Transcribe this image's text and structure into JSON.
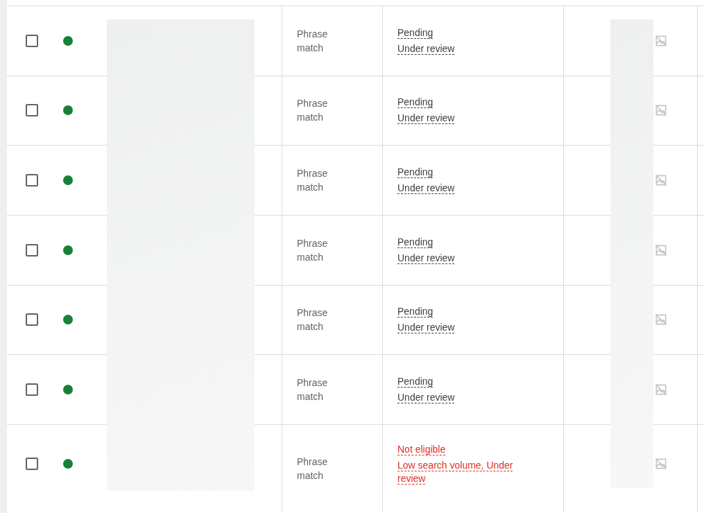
{
  "rows": [
    {
      "checked": false,
      "color": "#188038",
      "match_type": "Phrase match",
      "status": {
        "kind": "pending",
        "label": "Pending",
        "reason": "Under review"
      }
    },
    {
      "checked": false,
      "color": "#188038",
      "match_type": "Phrase match",
      "status": {
        "kind": "pending",
        "label": "Pending",
        "reason": "Under review"
      }
    },
    {
      "checked": false,
      "color": "#188038",
      "match_type": "Phrase match",
      "status": {
        "kind": "pending",
        "label": "Pending",
        "reason": "Under review"
      }
    },
    {
      "checked": false,
      "color": "#188038",
      "match_type": "Phrase match",
      "status": {
        "kind": "pending",
        "label": "Pending",
        "reason": "Under review"
      }
    },
    {
      "checked": false,
      "color": "#188038",
      "match_type": "Phrase match",
      "status": {
        "kind": "pending",
        "label": "Pending",
        "reason": "Under review"
      }
    },
    {
      "checked": false,
      "color": "#188038",
      "match_type": "Phrase match",
      "status": {
        "kind": "pending",
        "label": "Pending",
        "reason": "Under review"
      }
    },
    {
      "checked": false,
      "color": "#188038",
      "match_type": "Phrase match",
      "status": {
        "kind": "not_eligible",
        "label": "Not eligible",
        "reason": "Low search volume, Under review"
      }
    }
  ]
}
